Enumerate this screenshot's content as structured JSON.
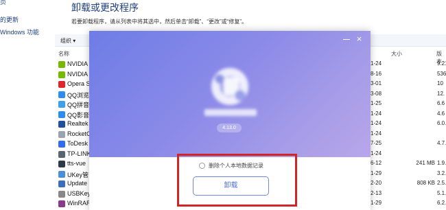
{
  "sidebar": {
    "items": [
      {
        "label": "页"
      },
      {
        "label": "的更新"
      },
      {
        "label": "Windows 功能"
      }
    ]
  },
  "header": {
    "title": "卸载或更改程序",
    "subtitle": "若要卸载程序，请从列表中将其选中，然后单击“卸载”、“更改”或“修复”。"
  },
  "toolbar": {
    "organize_label": "组织 ▾"
  },
  "table": {
    "columns": {
      "name": "名称",
      "size": "大小",
      "version": "版本"
    },
    "rows": [
      {
        "name": "NVIDIA",
        "date": "1-24",
        "size": "",
        "version": "9.21",
        "color": "#76b900",
        "icon": "nvidia-icon"
      },
      {
        "name": "NVIDIA",
        "date": "8-16",
        "size": "",
        "version": "536",
        "color": "#76b900",
        "icon": "nvidia-icon"
      },
      {
        "name": "Opera S",
        "date": "3-01",
        "size": "",
        "version": "10",
        "color": "#e0262b",
        "icon": "opera-icon"
      },
      {
        "name": "QQ浏览",
        "date": "3-08",
        "size": "",
        "version": "12.",
        "color": "#2d8cf0",
        "icon": "qq-browser-icon"
      },
      {
        "name": "QQ拼音",
        "date": "1-25",
        "size": "",
        "version": "6.6",
        "color": "#3aa0f0",
        "icon": "qq-pinyin-icon"
      },
      {
        "name": "QQ影音",
        "date": "1-24",
        "size": "",
        "version": "4.6",
        "color": "#2d8cf0",
        "icon": "qq-player-icon"
      },
      {
        "name": "Realtek",
        "date": "1-24",
        "size": "",
        "version": "6.0.",
        "color": "#1f4fa0",
        "icon": "realtek-icon"
      },
      {
        "name": "RocketC",
        "date": "1-24",
        "size": "",
        "version": "",
        "color": "#9aa4b0",
        "icon": "rocket-icon"
      },
      {
        "name": "ToDesk",
        "date": "7-25",
        "size": "",
        "version": "4.7.",
        "color": "#2f6df0",
        "icon": "todesk-icon"
      },
      {
        "name": "TP-LINK",
        "date": "1-24",
        "size": "",
        "version": "",
        "color": "#5a6570",
        "icon": "tplink-icon"
      },
      {
        "name": "tts-vue",
        "date": "6-12",
        "size": "241 MB",
        "version": "1.9.",
        "color": "#2d3a4a",
        "icon": "tts-vue-icon"
      },
      {
        "name": "UKey管",
        "date": "1-29",
        "size": "",
        "version": "3.2.",
        "color": "#4a90d9",
        "icon": "ukey-icon"
      },
      {
        "name": "Update",
        "date": "2-20",
        "size": "808 KB",
        "version": "2.5.",
        "color": "#3a6fc0",
        "icon": "update-icon"
      },
      {
        "name": "USBKey",
        "date": "2-13",
        "size": "",
        "version": "5.1.",
        "color": "#888888",
        "icon": "usbkey-icon"
      },
      {
        "name": "WinRAR",
        "date": "1-29",
        "size": "",
        "version": "6.2.",
        "color": "#8b3a8b",
        "icon": "winrar-icon"
      }
    ]
  },
  "dialog": {
    "version": "4.13.0",
    "option_label": "删除个人本地数据记录",
    "uninstall_label": "卸载",
    "close_glyph": "×",
    "banner_colors": [
      "#6d7de6",
      "#b8a6ea"
    ],
    "highlight_color": "#d32424"
  }
}
